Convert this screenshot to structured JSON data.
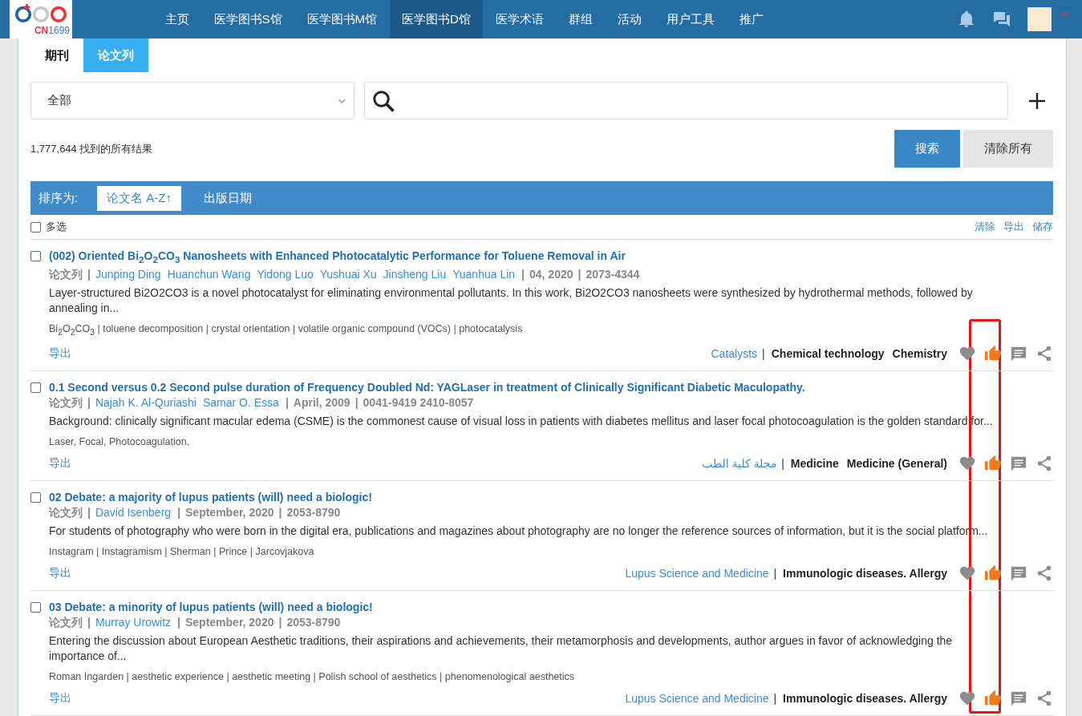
{
  "logo": {
    "text": "CN",
    "number": "1699"
  },
  "nav": [
    {
      "label": "主页",
      "selected": false
    },
    {
      "label": "医学图书S馆",
      "selected": false
    },
    {
      "label": "医学图书M馆",
      "selected": false
    },
    {
      "label": "医学图书D馆",
      "selected": true
    },
    {
      "label": "医学术语",
      "selected": false
    },
    {
      "label": "群组",
      "selected": false
    },
    {
      "label": "活动",
      "selected": false
    },
    {
      "label": "用户工具",
      "selected": false
    },
    {
      "label": "推广",
      "selected": false
    }
  ],
  "tabs": [
    {
      "label": "期刊",
      "selected": false
    },
    {
      "label": "论文列",
      "selected": true
    }
  ],
  "filter": {
    "value": "全部"
  },
  "result_count": "1,777,644 找到的所有结果",
  "buttons": [
    {
      "label": "搜索",
      "kind": "primary"
    },
    {
      "label": "清除所有",
      "kind": "secondary"
    }
  ],
  "sort": {
    "label": "排序为:",
    "options": [
      {
        "label": "论文名 A-Z↑",
        "selected": true
      },
      {
        "label": "出版日期",
        "selected": false
      }
    ]
  },
  "select_all": {
    "label": "多选",
    "checked": false
  },
  "list_actions": [
    "清除",
    "导出",
    "储存"
  ],
  "separator": "|",
  "articles": [
    {
      "checked": false,
      "title": "(002) Oriented Bi$_{2}$O$_{2}$CO$_{3}$ Nanosheets with Enhanced Photocatalytic Performance for Toluene Removal in Air",
      "type": "论文列",
      "authors": [
        "Junping Ding",
        "Huanchun Wang",
        "Yidong Luo",
        "Yushuai Xu",
        "Jinsheng Liu",
        "Yuanhua Lin"
      ],
      "meta": [
        "04, 2020",
        "2073-4344"
      ],
      "abstract": "Layer-structured Bi2O2CO3 is a novel photocatalyst for eliminating environmental pollutants. In this work, Bi2O2CO3 nanosheets were synthesized by hydrothermal methods, followed by annealing in...",
      "keywords": "Bi$_{2}$O$_{2}$CO$_{3}$ | toluene decomposition | crystal orientation | volatile organic compound (VOCs) | photocatalysis",
      "export": "导出",
      "journal": "Catalysts",
      "subjects": [
        "Chemical technology",
        "Chemistry"
      ],
      "liked": true
    },
    {
      "checked": false,
      "title": "0.1 Second versus 0.2 Second pulse duration of Frequency Doubled Nd: YAGLaser in treatment of Clinically Significant Diabetic Maculopathy.",
      "type": "论文列",
      "authors": [
        "Najah K. Al-Quriashi",
        "Samar O. Essa"
      ],
      "meta": [
        "April, 2009",
        "0041-9419 2410-8057"
      ],
      "abstract": "Background: clinically significant macular edema (CSME) is the commonest cause of visual loss in patients with diabetes mellitus and laser focal photocoagulation is the golden standard for...",
      "keywords": "Laser, Focal, Photocoagulation.",
      "export": "导出",
      "journal": "مجلة كلية الطب",
      "subjects": [
        "Medicine",
        "Medicine (General)"
      ],
      "liked": true
    },
    {
      "checked": false,
      "title": "02 Debate: a majority of lupus patients (will) need a biologic!",
      "type": "论文列",
      "authors": [
        "David Isenberg"
      ],
      "meta": [
        "September, 2020",
        "2053-8790"
      ],
      "abstract": "For students of photography who were born in the digital era, publications and magazines about photography are no longer the reference sources of information, but it is the social platform...",
      "keywords": "Instagram | Instagramism | Sherman | Prince | Jarcovjakova",
      "export": "导出",
      "journal": "Lupus Science and Medicine",
      "subjects": [
        "Immunologic diseases. Allergy"
      ],
      "liked": true
    },
    {
      "checked": false,
      "title": "03 Debate: a minority of lupus patients (will) need a biologic!",
      "type": "论文列",
      "authors": [
        "Murray Urowitz"
      ],
      "meta": [
        "September, 2020",
        "2053-8790"
      ],
      "abstract": "Entering the discussion about European Aesthetic traditions, their aspirations and achievements, their metamorphosis and developments, author argues in favor of acknowledging the importance of...",
      "keywords": "Roman Ingarden | aesthetic experience | aesthetic meeting | Polish school of aesthetics | phenomenological aesthetics",
      "export": "导出",
      "journal": "Lupus Science and Medicine",
      "subjects": [
        "Immunologic diseases. Allergy"
      ],
      "liked": true
    }
  ],
  "annotation": {
    "visible": true
  }
}
